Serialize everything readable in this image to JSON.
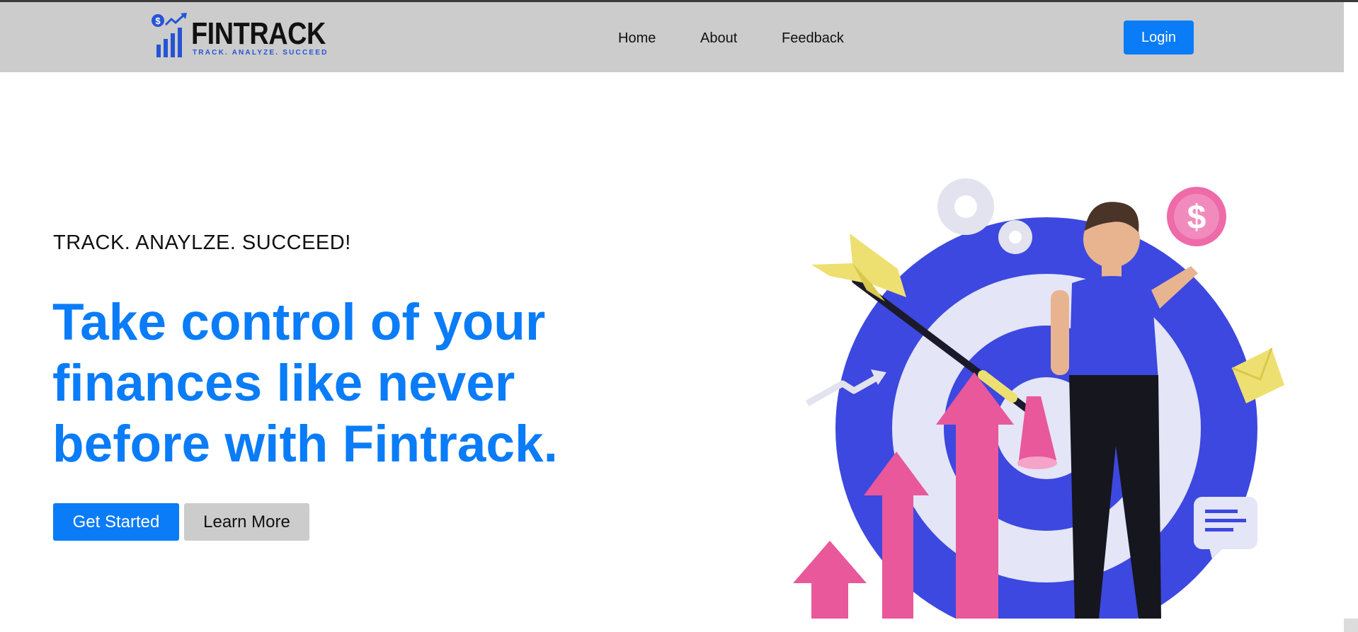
{
  "header": {
    "logo": {
      "name": "FINTRACK",
      "tagline": "TRACK. ANALYZE. SUCCEED"
    },
    "nav": [
      {
        "label": "Home"
      },
      {
        "label": "About"
      },
      {
        "label": "Feedback"
      }
    ],
    "login_label": "Login"
  },
  "hero": {
    "subtitle": "TRACK. ANAYLZE. SUCCEED!",
    "title": "Take control of your finances like never before with Fintrack.",
    "primary_button": "Get Started",
    "secondary_button": "Learn More",
    "illustration": "$"
  },
  "colors": {
    "accent": "#0a7cf7",
    "navbar_bg": "#cccccc",
    "target_blue": "#3d48e0",
    "arrow_pink": "#e8589a",
    "dart_yellow": "#eee070"
  }
}
